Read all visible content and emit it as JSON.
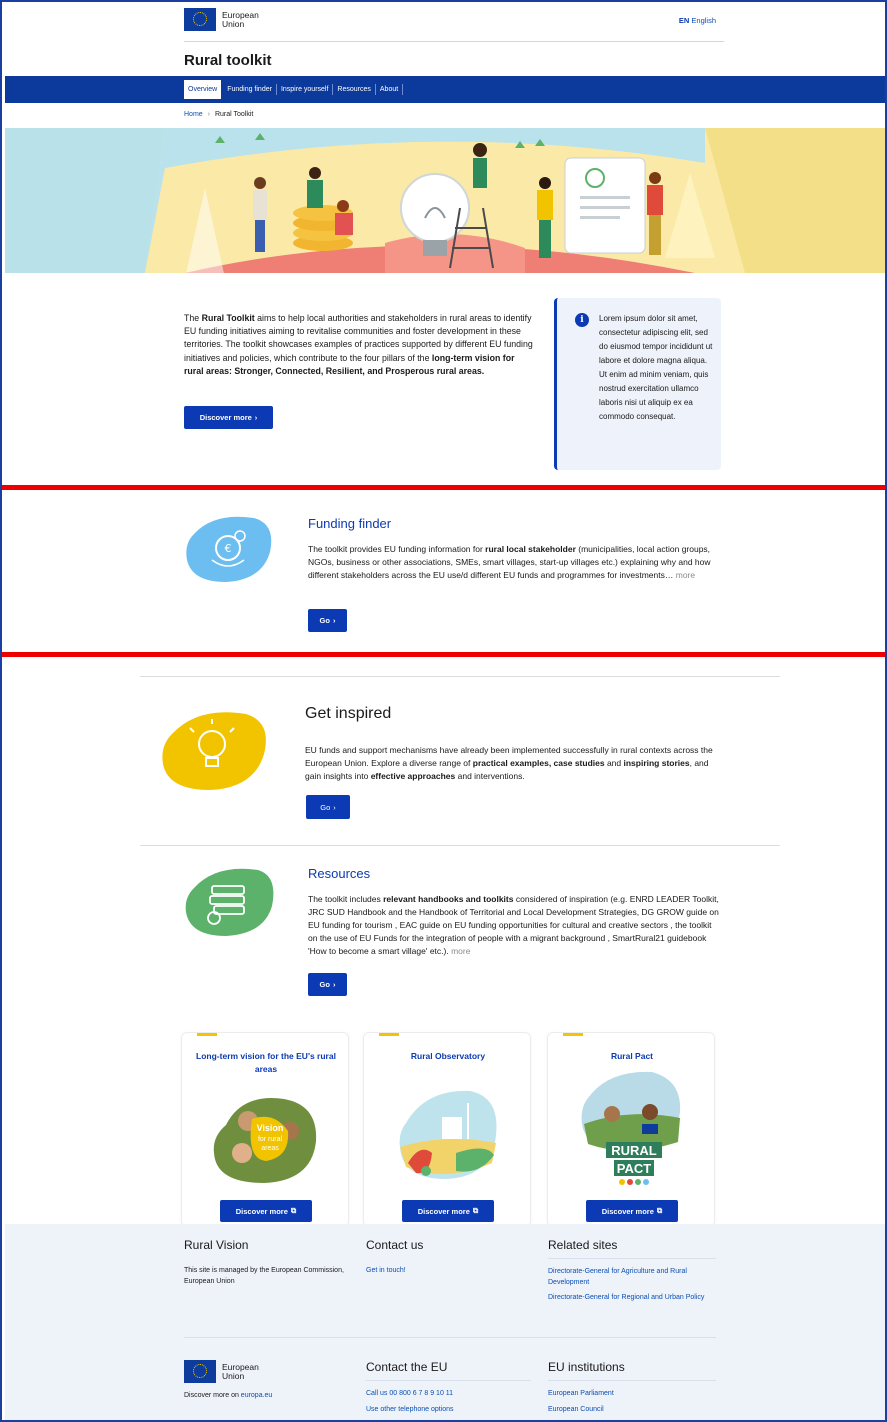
{
  "header": {
    "eu_logo_line1": "European",
    "eu_logo_line2": "Union",
    "lang_code": "EN",
    "lang_name": "English",
    "site_title": "Rural toolkit"
  },
  "nav": {
    "items": [
      {
        "label": "Overview"
      },
      {
        "label": "Funding finder"
      },
      {
        "label": "Inspire yourself"
      },
      {
        "label": "Resources"
      },
      {
        "label": "About"
      }
    ]
  },
  "breadcrumb": {
    "home": "Home",
    "sep": "›",
    "current": "Rural Toolkit"
  },
  "intro": {
    "p1": "The ",
    "b1": "Rural Toolkit",
    "p2": " aims to help local authorities and stakeholders in rural areas to identify EU funding initiatives aiming to revitalise communities and foster development in these territories. The toolkit showcases examples of practices supported by different EU funding initiatives and policies, which contribute to the four pillars of the ",
    "b2": "long-term vision for rural areas: Stronger, Connected, Resilient, and Prosperous rural areas.",
    "button": "Discover more"
  },
  "info_box": {
    "icon": "info-icon",
    "text": "Lorem ipsum dolor sit amet, consectetur adipiscing elit, sed do eiusmod tempor incididunt ut labore et dolore magna aliqua. Ut enim ad minim veniam, quis nostrud exercitation ullamco laboris nisi ut aliquip ex ea commodo consequat."
  },
  "funding": {
    "title": "Funding finder",
    "p1": "The toolkit provides EU funding information for ",
    "b1": "rural local stakeholder",
    "p2": " (municipalities, local action groups, NGOs, business or other associations, SMEs, smart villages, start-up villages etc.) explaining why and how different stakeholders across the EU use/d different EU funds and programmes for investments…",
    "more": "more",
    "button": "Go"
  },
  "inspired": {
    "title": "Get inspired",
    "p1": "EU funds and support mechanisms have already been implemented successfully in rural contexts across the European Union. Explore a diverse range of ",
    "b1": "practical examples, case studies",
    "p2": " and ",
    "b2": "inspiring stories",
    "p3": ", and gain insights into ",
    "b3": "effective approaches",
    "p4": " and interventions.",
    "button": "Go"
  },
  "resources": {
    "title": "Resources",
    "p1": "The toolkit includes ",
    "b1": "relevant handbooks and toolkits",
    "p2": " considered of inspiration (e.g. ENRD LEADER Toolkit, JRC SUD Handbook and the Handbook of Territorial and Local Development Strategies, DG GROW guide on EU funding for tourism , EAC guide on EU funding opportunities for cultural and creative sectors , the toolkit on the use of EU Funds for the integration of people with a migrant background , SmartRural21 guidebook 'How to become a smart village'  etc.).",
    "more": "more",
    "button": "Go"
  },
  "cards": [
    {
      "title": "Long-term vision for the EU's rural areas",
      "image_text_1": "Vision",
      "image_text_2": "for rural",
      "image_text_3": "areas",
      "button": "Discover more"
    },
    {
      "title": "Rural Observatory",
      "button": "Discover more"
    },
    {
      "title": "Rural Pact",
      "image_text_1": "RURAL",
      "image_text_2": "PACT",
      "button": "Discover more"
    }
  ],
  "footer": {
    "rural_vision": {
      "title": "Rural Vision",
      "text": "This site is managed by the European Commission, European Union"
    },
    "contact": {
      "title": "Contact us",
      "link": "Get in touch!"
    },
    "related": {
      "title": "Related sites",
      "links": [
        "Directorate-General for Agriculture and Rural Development",
        "Directorate-General for Regional and Urban Policy"
      ]
    },
    "eu": {
      "logo1": "European",
      "logo2": "Union",
      "discover": "Discover more on ",
      "discover_link": "europa.eu"
    },
    "contact_eu": {
      "title": "Contact the EU",
      "links": [
        "Call us 00 800 6 7 8 9 10 11",
        "Use other telephone options"
      ]
    },
    "institutions": {
      "title": "EU institutions",
      "links": [
        "European Parliament",
        "European Council"
      ]
    }
  },
  "colors": {
    "primary": "#0b3ab4",
    "nav": "#0b3a9c",
    "red_marker": "#ee0000",
    "funding_blob": "#6cbef0",
    "inspired_blob": "#f2c400",
    "resources_blob": "#5cb26a",
    "footer_bg": "#eef2f9"
  }
}
